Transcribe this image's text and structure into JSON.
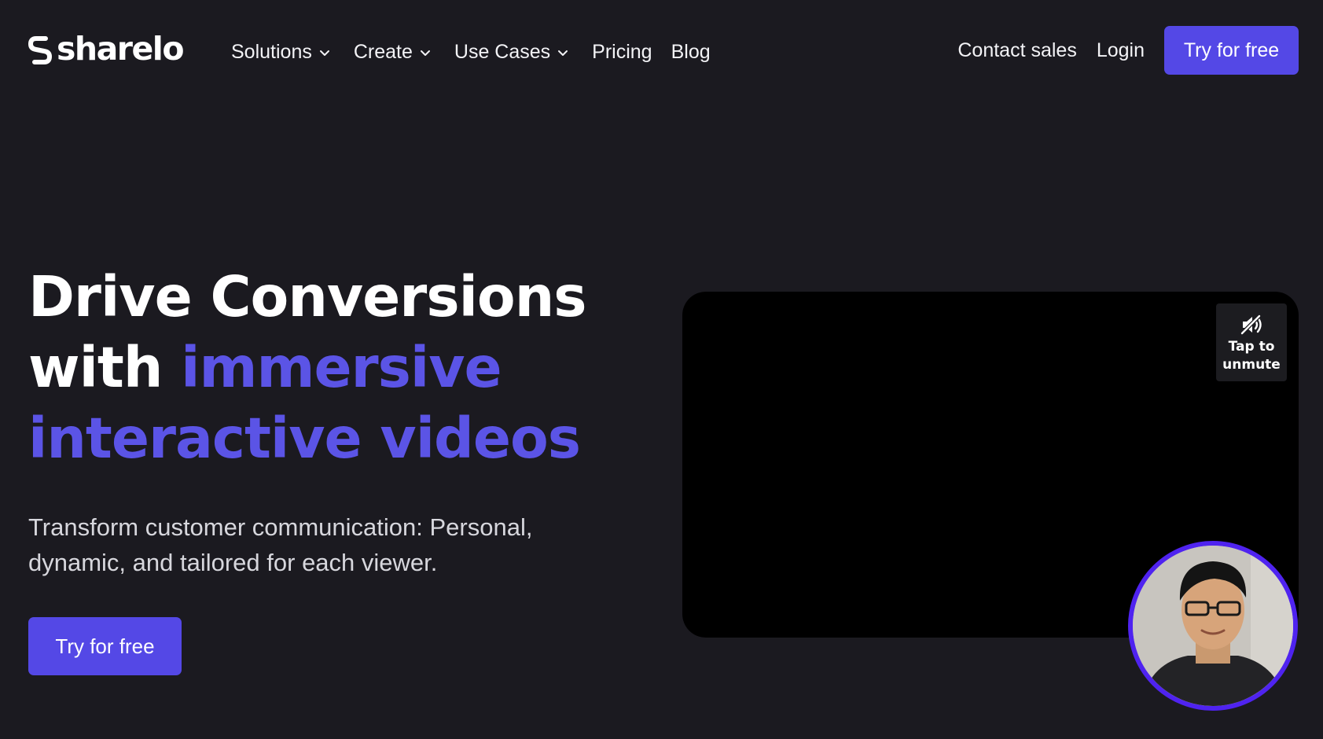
{
  "brand": {
    "name": "sharelo",
    "logo_icon": "sharelo-s-mark-icon"
  },
  "nav": {
    "items": [
      {
        "label": "Solutions",
        "has_dropdown": true
      },
      {
        "label": "Create",
        "has_dropdown": true
      },
      {
        "label": "Use Cases",
        "has_dropdown": true
      },
      {
        "label": "Pricing",
        "has_dropdown": false
      },
      {
        "label": "Blog",
        "has_dropdown": false
      }
    ],
    "contact_label": "Contact sales",
    "login_label": "Login",
    "cta_label": "Try for free"
  },
  "hero": {
    "title_line1": "Drive Conversions",
    "title_with": "with",
    "title_accent_1": "immersive",
    "title_accent_2": "interactive videos",
    "subtitle": "Transform customer communication: Personal, dynamic, and tailored for each viewer.",
    "cta_label": "Try for free"
  },
  "video": {
    "unmute_label_line1": "Tap to",
    "unmute_label_line2": "unmute",
    "unmute_icon": "speaker-muted-icon",
    "presenter_icon": "presenter-avatar"
  },
  "colors": {
    "background": "#1b1a20",
    "accent": "#5b54e6",
    "button": "#5448e6",
    "avatar_ring": "#4f23f0",
    "video_bg": "#000000"
  }
}
